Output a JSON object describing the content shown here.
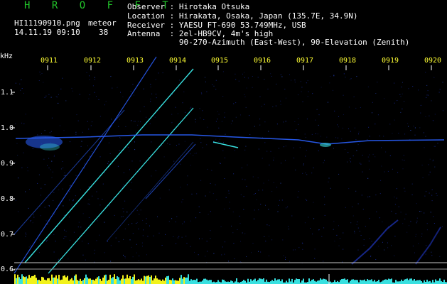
{
  "header": {
    "brand": "H R O F F T",
    "filename": "HI11190910.png",
    "timestamp": "14.11.19 09:10",
    "meteor_label": "meteor",
    "meteor_count": "38"
  },
  "info": {
    "observer": "Observer : Hirotaka Otsuka",
    "location": "Location : Hirakata, Osaka, Japan (135.7E, 34.9N)",
    "receiver": "Receiver : YAESU FT-690 53.749MHz, USB",
    "antenna": "Antenna  : 2el-HB9CV, 4m's high",
    "antenna_detail": "           90-270-Azimuth (East-West), 90-Elevation (Zenith)"
  },
  "axes": {
    "y_unit": "kHz",
    "y_ticks": [
      "1.1",
      "1.0",
      "0.9",
      "0.8",
      "0.7",
      "0.6"
    ],
    "x_ticks": [
      "0911",
      "0912",
      "0913",
      "0914",
      "0915",
      "0916",
      "0917",
      "0918",
      "0919",
      "0920"
    ]
  },
  "colors": {
    "background": "#000000",
    "brand": "#22c42a",
    "text": "#ffffff",
    "time_labels": "#ffff33",
    "trace_cyan": "#38e0e0",
    "trace_blue": "#2a60ff",
    "noise_blue": "#1b2fa8",
    "baseline_yellow": "#f2f21a"
  }
}
